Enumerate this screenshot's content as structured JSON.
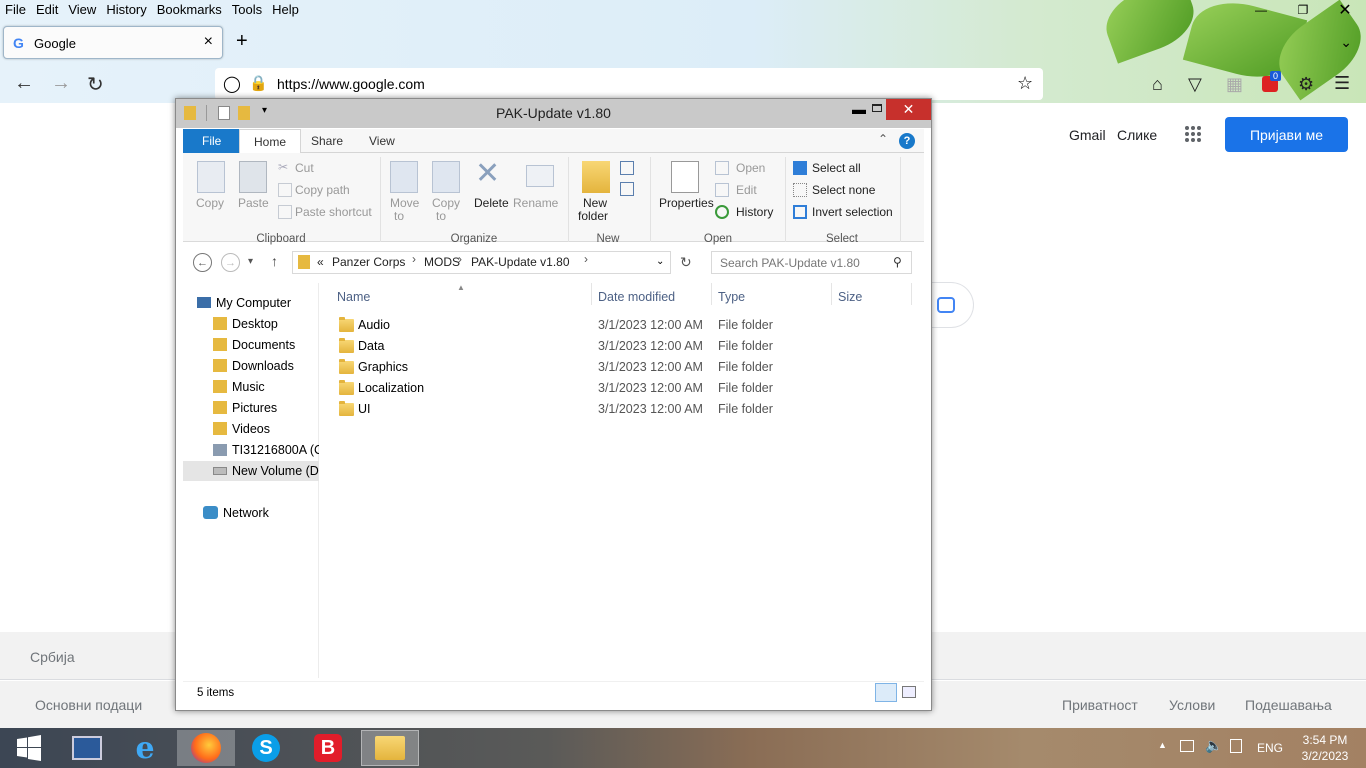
{
  "browser": {
    "menu": [
      "File",
      "Edit",
      "View",
      "History",
      "Bookmarks",
      "Tools",
      "Help"
    ],
    "tab_title": "Google",
    "tab_favicon": "G",
    "url": "https://www.google.com",
    "badge_count": "0"
  },
  "google": {
    "gmail": "Gmail",
    "images": "Слике",
    "signin": "Пријави ме",
    "country": "Србија",
    "footer_left": [
      "Основни подаци"
    ],
    "footer_right": [
      "Приватност",
      "Услови",
      "Подешавања"
    ]
  },
  "explorer": {
    "title": "PAK-Update v1.80",
    "ribbon_tabs": [
      "File",
      "Home",
      "Share",
      "View"
    ],
    "clipboard": {
      "copy": "Copy",
      "paste": "Paste",
      "cut": "Cut",
      "copy_path": "Copy path",
      "paste_shortcut": "Paste shortcut",
      "group": "Clipboard"
    },
    "organize": {
      "move_to_1": "Move",
      "move_to_2": "to",
      "copy_to_1": "Copy",
      "copy_to_2": "to",
      "delete": "Delete",
      "rename": "Rename",
      "group": "Organize"
    },
    "new": {
      "new_folder_1": "New",
      "new_folder_2": "folder",
      "group": "New"
    },
    "open": {
      "properties": "Properties",
      "open": "Open",
      "edit": "Edit",
      "history": "History",
      "group": "Open"
    },
    "select": {
      "select_all": "Select all",
      "select_none": "Select none",
      "invert": "Invert selection",
      "group": "Select"
    },
    "breadcrumb": [
      "«",
      "Panzer Corps",
      "MODS",
      "PAK-Update v1.80"
    ],
    "search_placeholder": "Search PAK-Update v1.80",
    "nav": [
      {
        "label": "My Computer"
      },
      {
        "label": "Desktop"
      },
      {
        "label": "Documents"
      },
      {
        "label": "Downloads"
      },
      {
        "label": "Music"
      },
      {
        "label": "Pictures"
      },
      {
        "label": "Videos"
      },
      {
        "label": "TI31216800A (C:"
      },
      {
        "label": "New Volume (D"
      },
      {
        "label": "Network"
      }
    ],
    "columns": [
      "Name",
      "Date modified",
      "Type",
      "Size"
    ],
    "files": [
      {
        "name": "Audio",
        "date": "3/1/2023 12:00 AM",
        "type": "File folder"
      },
      {
        "name": "Data",
        "date": "3/1/2023 12:00 AM",
        "type": "File folder"
      },
      {
        "name": "Graphics",
        "date": "3/1/2023 12:00 AM",
        "type": "File folder"
      },
      {
        "name": "Localization",
        "date": "3/1/2023 12:00 AM",
        "type": "File folder"
      },
      {
        "name": "UI",
        "date": "3/1/2023 12:00 AM",
        "type": "File folder"
      }
    ],
    "status": "5 items"
  },
  "taskbar": {
    "lang": "ENG",
    "time": "3:54 PM",
    "date": "3/2/2023"
  }
}
